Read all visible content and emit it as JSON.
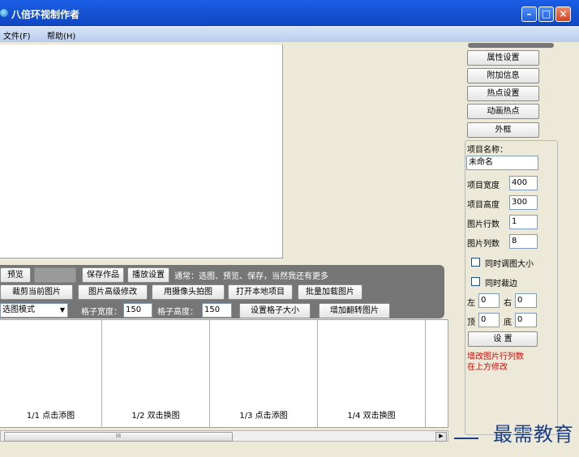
{
  "window": {
    "title": "八倍环视制作者"
  },
  "menu": {
    "file": "文件(F)",
    "help": "帮助(H)"
  },
  "toolbar": {
    "preview": "预览",
    "save_work": "保存作品",
    "play_settings": "播放设置",
    "hint": "通常：选图、预览、保存，当然我还有更多",
    "crop_current": "裁剪当前图片",
    "advanced_edit": "图片高级修改",
    "camera_capture": "用摄像头拍图",
    "open_local": "打开本地项目",
    "batch_load": "批量加载图片",
    "mode_select": "选图模式",
    "grid_width_label": "格子宽度：",
    "grid_width_value": "150",
    "grid_height_label": "格子高度：",
    "grid_height_value": "150",
    "set_grid_size": "设置格子大小",
    "add_flip_image": "增加翻转图片"
  },
  "thumbnails": [
    {
      "label": "1/1 点击添图"
    },
    {
      "label": "1/2 双击换图"
    },
    {
      "label": "1/3 点击添图"
    },
    {
      "label": "1/4 双击换图"
    }
  ],
  "scrollbar": {
    "thumb_grip": "III"
  },
  "side_buttons": {
    "property": "属性设置",
    "extra_info": "附加信息",
    "hotspot": "热点设置",
    "anim_hotspot": "动画热点",
    "frame": "外框"
  },
  "properties": {
    "name_label": "项目名称：",
    "name_value": "未命名",
    "width_label": "项目宽度",
    "width_value": "400",
    "height_label": "项目高度",
    "height_value": "300",
    "rows_label": "图片行数",
    "rows_value": "1",
    "cols_label": "图片列数",
    "cols_value": "8",
    "sync_resize": "同时调图大小",
    "sync_crop": "同时裁边",
    "left_label": "左",
    "left_value": "0",
    "right_label": "右",
    "right_value": "0",
    "top_label": "顶",
    "top_value": "0",
    "bottom_label": "底",
    "bottom_value": "0",
    "set_button": "设 置",
    "note_line1": "增改图片行列数",
    "note_line2": "在上方修改"
  },
  "watermark": "最需教育"
}
